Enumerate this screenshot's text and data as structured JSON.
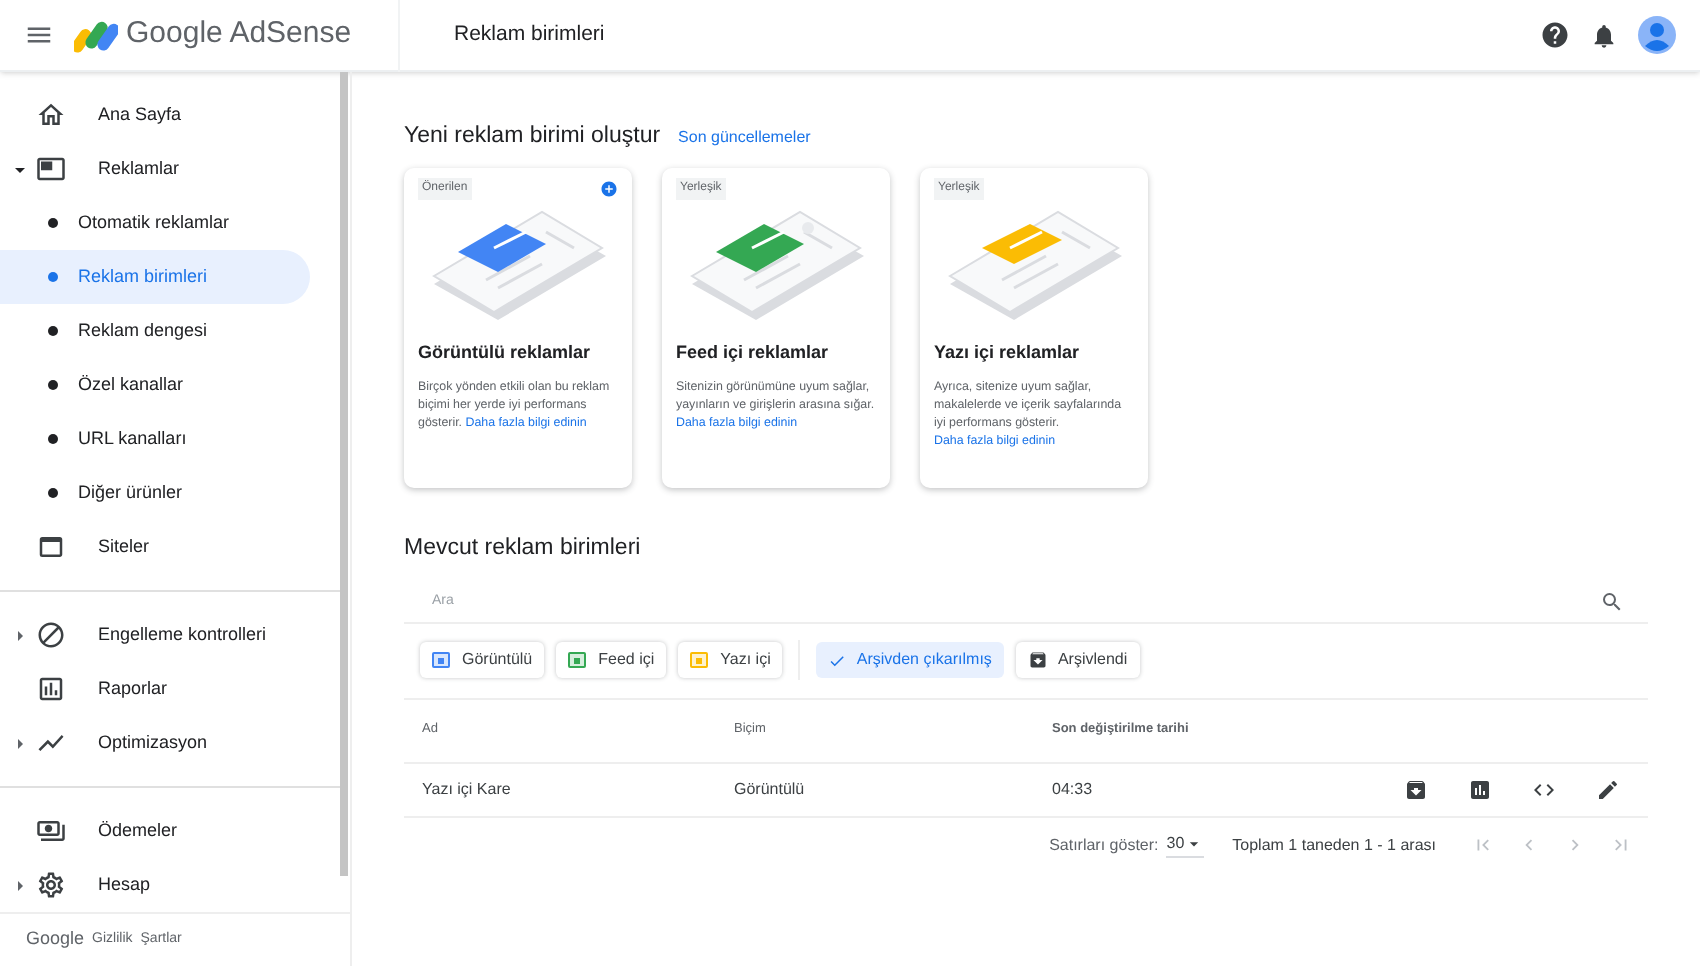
{
  "header": {
    "product": "Google AdSense",
    "page_title": "Reklam birimleri"
  },
  "sidebar": {
    "items": [
      {
        "label": "Ana Sayfa",
        "kind": "link"
      },
      {
        "label": "Reklamlar",
        "kind": "group",
        "expanded": true,
        "children": [
          {
            "label": "Otomatik reklamlar",
            "selected": false
          },
          {
            "label": "Reklam birimleri",
            "selected": true
          },
          {
            "label": "Reklam dengesi",
            "selected": false
          },
          {
            "label": "Özel kanallar",
            "selected": false
          },
          {
            "label": "URL kanalları",
            "selected": false
          },
          {
            "label": "Diğer ürünler",
            "selected": false
          }
        ]
      },
      {
        "label": "Siteler",
        "kind": "link",
        "divider_after": true
      },
      {
        "label": "Engelleme kontrolleri",
        "kind": "group",
        "expanded": false
      },
      {
        "label": "Raporlar",
        "kind": "link"
      },
      {
        "label": "Optimizasyon",
        "kind": "group",
        "expanded": false,
        "divider_after": true
      },
      {
        "label": "Ödemeler",
        "kind": "link"
      },
      {
        "label": "Hesap",
        "kind": "group",
        "expanded": false
      }
    ],
    "footer": [
      "Google",
      "Gizlilik",
      "Şartlar"
    ]
  },
  "create": {
    "title": "Yeni reklam birimi oluştur",
    "link": "Son güncellemeler",
    "cards": [
      {
        "tag": "Önerilen",
        "recommended": true,
        "color": "#4285f4",
        "title": "Görüntülü reklamlar",
        "description": "Birçok yönden etkili olan bu reklam biçimi her yerde iyi performans gösterir.",
        "link": "Daha fazla bilgi edinin"
      },
      {
        "tag": "Yerleşik",
        "recommended": false,
        "color": "#34a853",
        "title": "Feed içi reklamlar",
        "description": "Sitenizin görünümüne uyum sağlar, yayınların ve girişlerin arasına sığar.",
        "link": "Daha fazla bilgi edinin"
      },
      {
        "tag": "Yerleşik",
        "recommended": false,
        "color": "#fbbc04",
        "title": "Yazı içi reklamlar",
        "description": "Ayrıca, sitenize uyum sağlar, makalelerde ve içerik sayfalarında iyi performans gösterir.",
        "link": "Daha fazla bilgi edinin"
      }
    ]
  },
  "existing": {
    "title": "Mevcut reklam birimleri",
    "search": {
      "placeholder": "Ara"
    },
    "type_filters": [
      {
        "label": "Görüntülü",
        "color": "#4285f4"
      },
      {
        "label": "Feed içi",
        "color": "#34a853"
      },
      {
        "label": "Yazı içi",
        "color": "#fbbc04"
      }
    ],
    "status_filters": [
      {
        "label": "Arşivden çıkarılmış",
        "selected": true
      },
      {
        "label": "Arşivlendi",
        "selected": false
      }
    ],
    "table": {
      "columns": [
        "Ad",
        "Biçim",
        "Son değiştirilme tarihi"
      ],
      "rows": [
        {
          "cells": [
            "Yazı içi Kare",
            "Görüntülü",
            "04:33"
          ]
        }
      ]
    },
    "pagination": {
      "rows_label": "Satırları göster:",
      "rows_value": "30",
      "summary": "Toplam 1 taneden 1 - 1 arası"
    }
  }
}
